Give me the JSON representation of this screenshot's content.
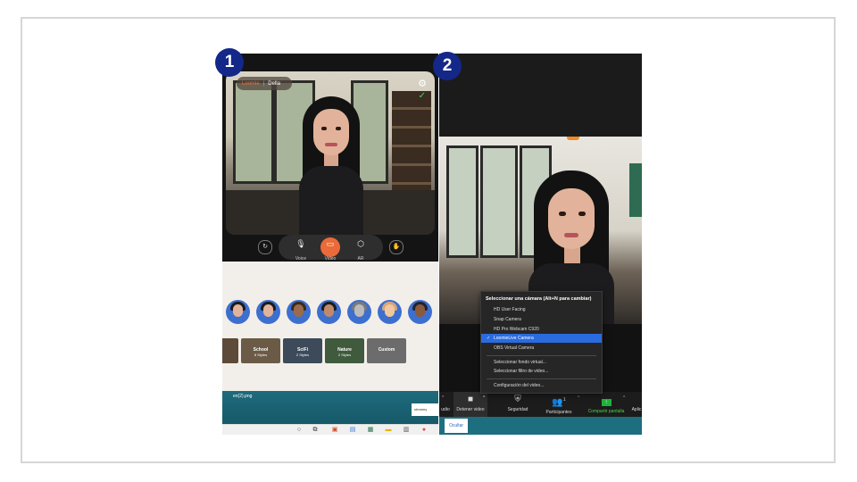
{
  "badges": [
    "1",
    "2"
  ],
  "panel1": {
    "brand": "Loomie",
    "user_name": "Della",
    "controls": {
      "voice": "Voice",
      "video": "Video",
      "ar": "AR"
    },
    "backgrounds": [
      {
        "title": "",
        "subtitle": ""
      },
      {
        "title": "School",
        "subtitle": "8 Styles"
      },
      {
        "title": "SciFi",
        "subtitle": "2 Styles"
      },
      {
        "title": "Nature",
        "subtitle": "2 Styles"
      },
      {
        "title": "Custom",
        "subtitle": ""
      }
    ],
    "desktop_file": "en(2).png",
    "streamy_label": "streamy"
  },
  "panel2": {
    "menu": {
      "header": "Seleccionar una cámara (Alt+N para cambiar)",
      "cameras": [
        "HD User Facing",
        "Snap Camera",
        "HD Pro Webcam C920",
        "LoomieLive Camera",
        "OBS Virtual Camera"
      ],
      "selected_index": 3,
      "options": [
        "Seleccionar fondo virtual...",
        "Seleccionar filtro de video..."
      ],
      "settings": "Configuración del video..."
    },
    "toolbar": {
      "audio": "udio",
      "stop_video": "Detener video",
      "security": "Seguridad",
      "participants": "Participantes",
      "participants_count": "1",
      "share": "Compartir pantalla",
      "apps": "Aplic"
    },
    "hide_button": "Ocultar"
  },
  "colors": {
    "badge": "#14288a",
    "video_button": "#ea6a3a",
    "selected": "#2a6be0",
    "share_green": "#1fb23b"
  }
}
